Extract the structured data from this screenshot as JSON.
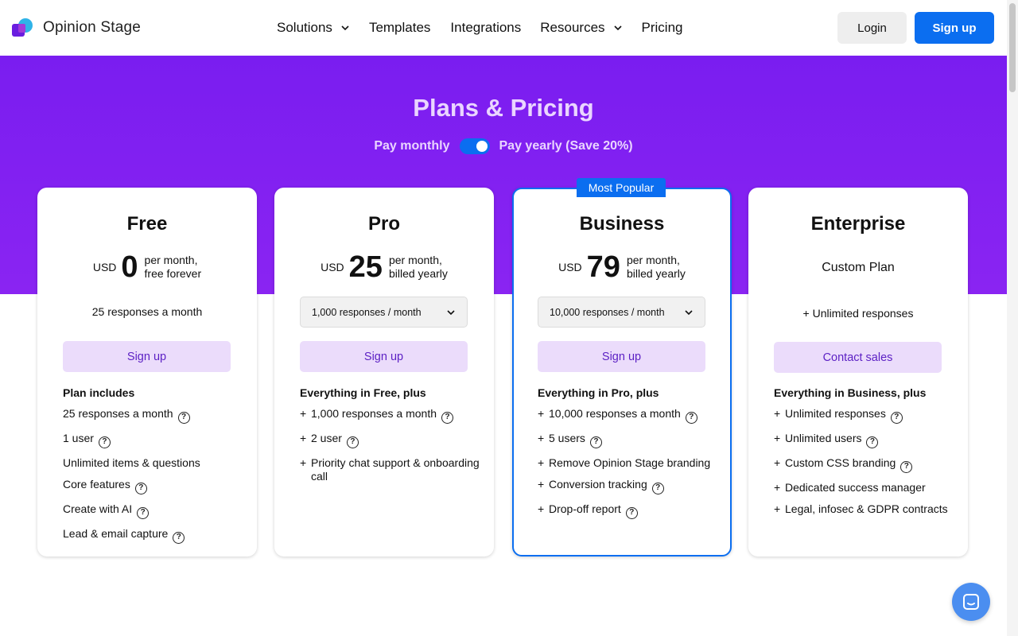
{
  "header": {
    "logo_text": "Opinion Stage",
    "nav": {
      "solutions": "Solutions",
      "templates": "Templates",
      "integrations": "Integrations",
      "resources": "Resources",
      "pricing": "Pricing"
    },
    "login_label": "Login",
    "signup_label": "Sign up"
  },
  "hero": {
    "title": "Plans & Pricing",
    "pay_monthly": "Pay monthly",
    "pay_yearly": "Pay yearly (Save 20%)"
  },
  "colors": {
    "accent": "#0b6ef0",
    "hero_bg": "#7a1df0",
    "cta_bg": "#ebdcfb",
    "cta_text": "#5b1fc4"
  },
  "plans": [
    {
      "name": "Free",
      "currency": "USD",
      "amount": "0",
      "period_line1": "per month,",
      "period_line2": "free forever",
      "responses": "25 responses a month",
      "cta": "Sign up",
      "includes_title": "Plan includes",
      "features": [
        {
          "prefix": "",
          "text": "25 responses a month",
          "help": true
        },
        {
          "prefix": "",
          "text": "1 user",
          "help": true
        },
        {
          "prefix": "",
          "text": "Unlimited items & questions",
          "help": false
        },
        {
          "prefix": "",
          "text": "Core features",
          "help": true
        },
        {
          "prefix": "",
          "text": "Create with AI",
          "help": true
        },
        {
          "prefix": "",
          "text": "Lead & email capture",
          "help": true
        }
      ]
    },
    {
      "name": "Pro",
      "currency": "USD",
      "amount": "25",
      "period_line1": "per month,",
      "period_line2": "billed yearly",
      "responses": "1,000 responses / month",
      "cta": "Sign up",
      "includes_title": "Everything in Free, plus",
      "features": [
        {
          "prefix": "+",
          "text": "1,000 responses a month",
          "help": true
        },
        {
          "prefix": "+",
          "text": "2 user",
          "help": true
        },
        {
          "prefix": "+",
          "text": "Priority chat support & onboarding call",
          "help": false
        }
      ]
    },
    {
      "name": "Business",
      "badge": "Most Popular",
      "currency": "USD",
      "amount": "79",
      "period_line1": "per month,",
      "period_line2": "billed yearly",
      "responses": "10,000 responses / month",
      "cta": "Sign up",
      "includes_title": "Everything in Pro, plus",
      "features": [
        {
          "prefix": "+",
          "text": "10,000 responses a month",
          "help": true
        },
        {
          "prefix": "+",
          "text": "5 users",
          "help": true
        },
        {
          "prefix": "+",
          "text": "Remove Opinion Stage branding",
          "help": false
        },
        {
          "prefix": "+",
          "text": "Conversion tracking",
          "help": true
        },
        {
          "prefix": "+",
          "text": "Drop-off report",
          "help": true
        }
      ]
    },
    {
      "name": "Enterprise",
      "custom": "Custom Plan",
      "responses": "+ Unlimited responses",
      "cta": "Contact sales",
      "includes_title": "Everything in Business, plus",
      "features": [
        {
          "prefix": "+",
          "text": "Unlimited responses",
          "help": true
        },
        {
          "prefix": "+",
          "text": "Unlimited users",
          "help": true
        },
        {
          "prefix": "+",
          "text": "Custom CSS branding",
          "help": true
        },
        {
          "prefix": "+",
          "text": "Dedicated success manager",
          "help": false
        },
        {
          "prefix": "+",
          "text": "Legal, infosec & GDPR contracts",
          "help": false
        }
      ]
    }
  ]
}
